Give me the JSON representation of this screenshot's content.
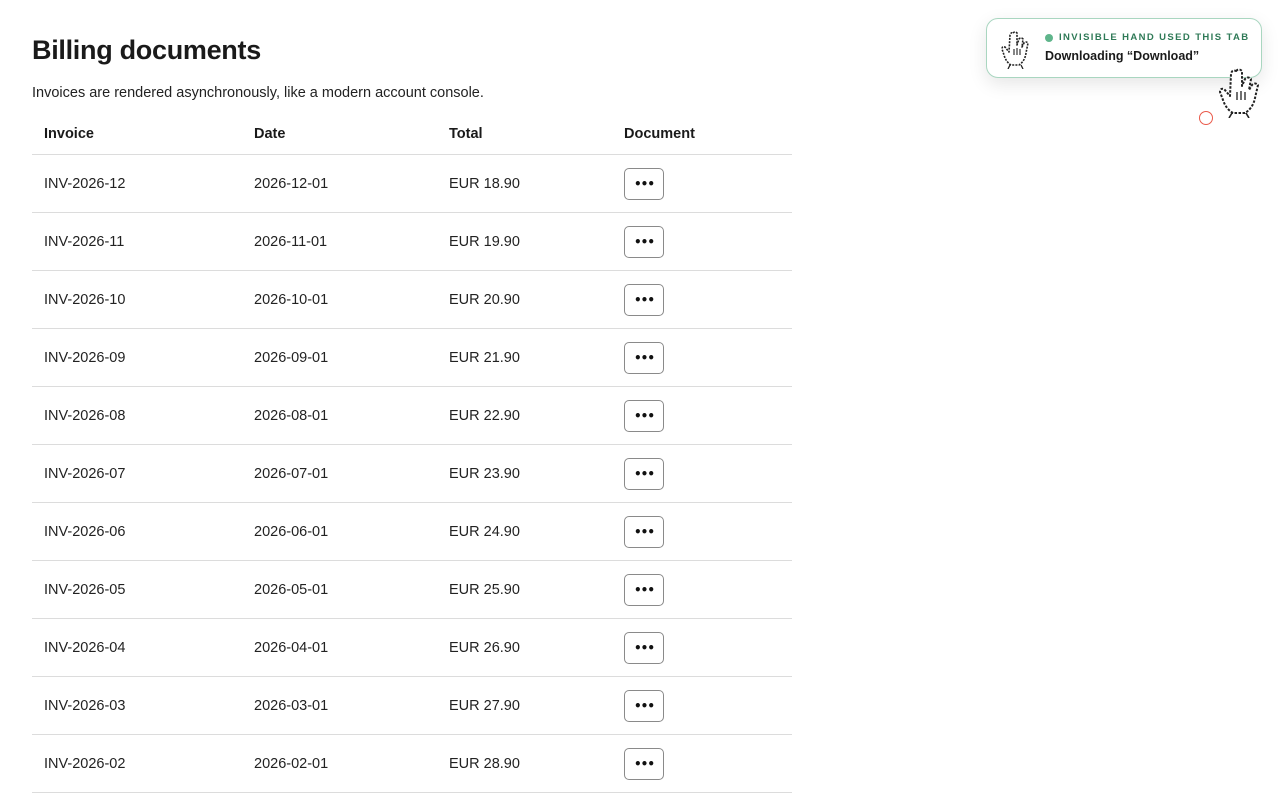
{
  "page": {
    "title": "Billing documents",
    "subtitle": "Invoices are rendered asynchronously, like a modern account console."
  },
  "table": {
    "headers": {
      "invoice": "Invoice",
      "date": "Date",
      "total": "Total",
      "document": "Document"
    },
    "rows": [
      {
        "invoice": "INV-2026-12",
        "date": "2026-12-01",
        "total": "EUR 18.90",
        "action": "•••"
      },
      {
        "invoice": "INV-2026-11",
        "date": "2026-11-01",
        "total": "EUR 19.90",
        "action": "•••"
      },
      {
        "invoice": "INV-2026-10",
        "date": "2026-10-01",
        "total": "EUR 20.90",
        "action": "•••"
      },
      {
        "invoice": "INV-2026-09",
        "date": "2026-09-01",
        "total": "EUR 21.90",
        "action": "•••"
      },
      {
        "invoice": "INV-2026-08",
        "date": "2026-08-01",
        "total": "EUR 22.90",
        "action": "•••"
      },
      {
        "invoice": "INV-2026-07",
        "date": "2026-07-01",
        "total": "EUR 23.90",
        "action": "•••"
      },
      {
        "invoice": "INV-2026-06",
        "date": "2026-06-01",
        "total": "EUR 24.90",
        "action": "•••"
      },
      {
        "invoice": "INV-2026-05",
        "date": "2026-05-01",
        "total": "EUR 25.90",
        "action": "•••"
      },
      {
        "invoice": "INV-2026-04",
        "date": "2026-04-01",
        "total": "EUR 26.90",
        "action": "•••"
      },
      {
        "invoice": "INV-2026-03",
        "date": "2026-03-01",
        "total": "EUR 27.90",
        "action": "•••"
      },
      {
        "invoice": "INV-2026-02",
        "date": "2026-02-01",
        "total": "EUR 28.90",
        "action": "•••"
      }
    ]
  },
  "toast": {
    "status": "INVISIBLE HAND USED THIS TAB",
    "action": "Downloading “Download”",
    "icon": "hand-cursor-icon",
    "accent_color": "#5fb58b",
    "border_color": "#a9d6c0"
  },
  "cursor": {
    "icon": "hand-cursor-icon",
    "click_indicator_color": "#ea5a4a"
  }
}
